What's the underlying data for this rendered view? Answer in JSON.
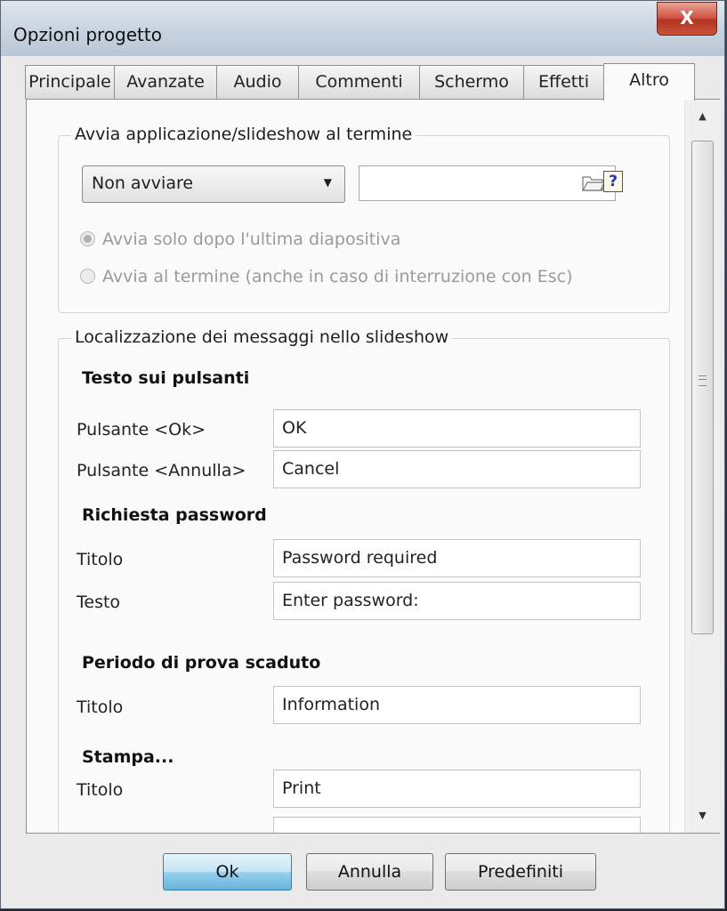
{
  "window": {
    "title": "Opzioni progetto",
    "close_glyph": "X"
  },
  "tabs": [
    {
      "label": "Principale",
      "active": false
    },
    {
      "label": "Avanzate",
      "active": false
    },
    {
      "label": "Audio",
      "active": false
    },
    {
      "label": "Commenti",
      "active": false
    },
    {
      "label": "Schermo",
      "active": false
    },
    {
      "label": "Effetti",
      "active": false
    },
    {
      "label": "Altro",
      "active": true
    }
  ],
  "launch_group": {
    "title": "Avvia applicazione/slideshow al termine",
    "select_value": "Non avviare",
    "path_value": "",
    "help_glyph": "?",
    "radio_after_last": "Avvia solo dopo l'ultima diapositiva",
    "radio_after_end": "Avvia al termine (anche in caso di interruzione con Esc)",
    "selected_radio": "radio_after_last"
  },
  "localization_group": {
    "title": "Localizzazione dei messaggi nello slideshow",
    "buttons_section": {
      "heading": "Testo sui pulsanti",
      "ok_label": "Pulsante <Ok>",
      "ok_value": "OK",
      "cancel_label": "Pulsante <Annulla>",
      "cancel_value": "Cancel"
    },
    "password_section": {
      "heading": "Richiesta password",
      "title_label": "Titolo",
      "title_value": "Password required",
      "text_label": "Testo",
      "text_value": "Enter password:"
    },
    "trial_section": {
      "heading": "Periodo di prova scaduto",
      "title_label": "Titolo",
      "title_value": "Information"
    },
    "print_section": {
      "heading": "Stampa...",
      "title_label": "Titolo",
      "title_value": "Print",
      "next_value": ""
    }
  },
  "footer": {
    "ok_label": "Ok",
    "cancel_label": "Annulla",
    "defaults_label": "Predefiniti"
  },
  "colors": {
    "close_button": "#c8553a",
    "default_button": "#98d1ef",
    "help_text": "#1a32c8"
  }
}
